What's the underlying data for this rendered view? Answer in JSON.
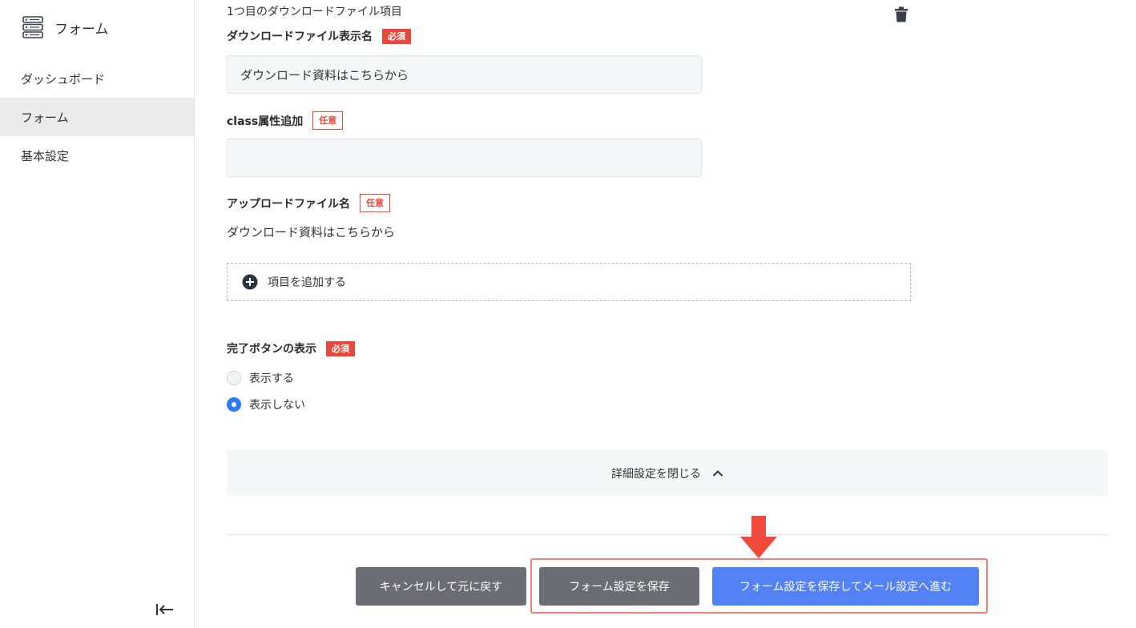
{
  "sidebar": {
    "brand": {
      "label": "フォーム",
      "icon": "server-icon"
    },
    "items": [
      {
        "label": "ダッシュボード",
        "active": false
      },
      {
        "label": "フォーム",
        "active": true
      },
      {
        "label": "基本設定",
        "active": false
      }
    ],
    "collapse_icon": "collapse-left-icon"
  },
  "main": {
    "section_title": "1つ目のダウンロードファイル項目",
    "delete_icon": "trash-icon",
    "download_name": {
      "label": "ダウンロードファイル表示名",
      "badge": "必須",
      "value": "ダウンロード資料はこちらから"
    },
    "class_attr": {
      "label": "class属性追加",
      "badge": "任意",
      "value": ""
    },
    "upload_name": {
      "label": "アップロードファイル名",
      "badge": "任意",
      "value": "ダウンロード資料はこちらから"
    },
    "add_item": {
      "label": "項目を追加する",
      "icon": "plus-circle-icon"
    },
    "complete_button": {
      "label": "完了ボタンの表示",
      "badge": "必須",
      "options": [
        {
          "label": "表示する",
          "checked": false
        },
        {
          "label": "表示しない",
          "checked": true
        }
      ]
    },
    "details_toggle": {
      "label": "詳細設定を閉じる",
      "icon": "chevron-up-icon"
    }
  },
  "footer": {
    "cancel_label": "キャンセルして元に戻す",
    "save_label": "フォーム設定を保存",
    "next_label": "フォーム設定を保存してメール設定へ進む"
  },
  "colors": {
    "accent": "#5382f5",
    "required_badge": "#e8473c",
    "annotation": "#f04a3c",
    "secondary_button": "#6a6d74",
    "radio_checked": "#2f7bf5"
  },
  "annotation": {
    "arrow_icon": "down-arrow-icon"
  }
}
